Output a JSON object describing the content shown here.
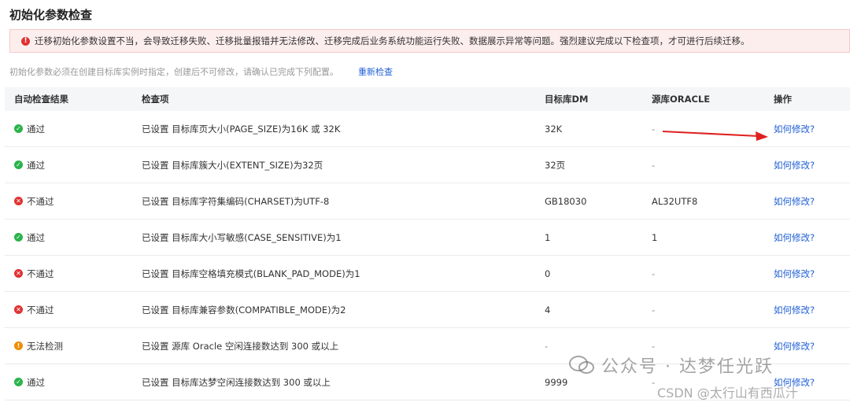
{
  "page": {
    "title": "初始化参数检查",
    "alert_text": "迁移初始化参数设置不当，会导致迁移失败、迁移批量报错并无法修改、迁移完成后业务系统功能运行失败、数据展示异常等问题。强烈建议完成以下检查项，才可进行后续迁移。",
    "hint": "初始化参数必须在创建目标库实例时指定，创建后不可修改，请确认已完成下列配置。",
    "recheck": "重新检查"
  },
  "colors": {
    "pass": "#2bb34b",
    "fail": "#e03131",
    "unknown": "#f08c00",
    "link": "#1f5fd6"
  },
  "table": {
    "headers": [
      "自动检查结果",
      "检查项",
      "目标库DM",
      "源库ORACLE",
      "操作"
    ],
    "rows": [
      {
        "status": "通过",
        "state": "pass",
        "item": "已设置 目标库页大小(PAGE_SIZE)为16K 或 32K",
        "dm": "32K",
        "oracle": "-",
        "action": "如何修改?"
      },
      {
        "status": "通过",
        "state": "pass",
        "item": "已设置 目标库簇大小(EXTENT_SIZE)为32页",
        "dm": "32页",
        "oracle": "-",
        "action": "如何修改?"
      },
      {
        "status": "不通过",
        "state": "fail",
        "item": "已设置 目标库字符集编码(CHARSET)为UTF-8",
        "dm": "GB18030",
        "oracle": "AL32UTF8",
        "action": "如何修改?"
      },
      {
        "status": "通过",
        "state": "pass",
        "item": "已设置 目标库大小写敏感(CASE_SENSITIVE)为1",
        "dm": "1",
        "oracle": "1",
        "action": "如何修改?"
      },
      {
        "status": "不通过",
        "state": "fail",
        "item": "已设置 目标库空格填充模式(BLANK_PAD_MODE)为1",
        "dm": "0",
        "oracle": "-",
        "action": "如何修改?"
      },
      {
        "status": "不通过",
        "state": "fail",
        "item": "已设置 目标库兼容参数(COMPATIBLE_MODE)为2",
        "dm": "4",
        "oracle": "-",
        "action": "如何修改?"
      },
      {
        "status": "无法检测",
        "state": "unknown",
        "item": "已设置 源库 Oracle 空闲连接数达到 300 或以上",
        "dm": "-",
        "oracle": "-",
        "action": "如何修改?"
      },
      {
        "status": "通过",
        "state": "pass",
        "item": "已设置 目标库达梦空闲连接数达到 300 或以上",
        "dm": "9999",
        "oracle": "-",
        "action": "如何修改?"
      }
    ]
  },
  "watermark": {
    "text": "公众号 · 达梦任光跃",
    "icon": "wechat-icon",
    "csdn": "CSDN @太行山有西瓜汁"
  }
}
